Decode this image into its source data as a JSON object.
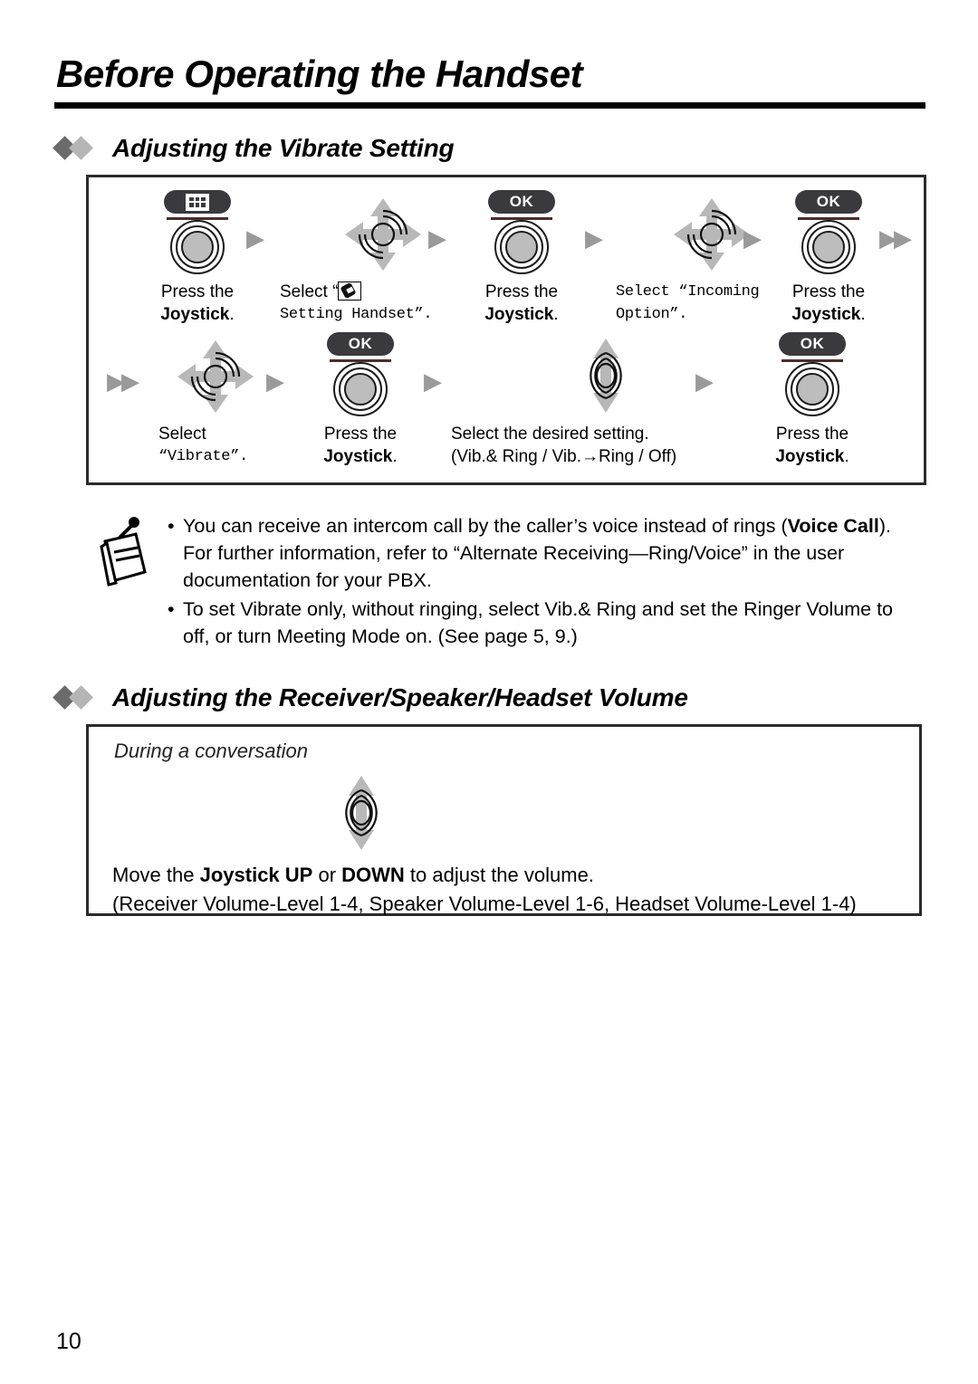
{
  "header": {
    "chapter_title": "Before Operating the Handset"
  },
  "sections": [
    {
      "heading": "Adjusting the Vibrate Setting"
    },
    {
      "heading": "Adjusting the Receiver/Speaker/Headset Volume"
    }
  ],
  "vibrate_procedure": {
    "row1": [
      {
        "icon": "menu-key-press-joystick-icon",
        "key_label": "",
        "line1": "Press the",
        "line2": "Joystick.",
        "line1_mono": false,
        "line2_mono": false,
        "line2_bold": true,
        "trailing_period": "."
      },
      {
        "icon": "joystick-4way-icon",
        "line1": "Select “",
        "line2": "Setting Handset”.",
        "line1_mono": false,
        "line2_mono": true,
        "line2_bold": false
      },
      {
        "icon": "ok-key-press-joystick-icon",
        "key_label": "OK",
        "line1": "Press the",
        "line2": "Joystick.",
        "line2_bold": true
      },
      {
        "icon": "joystick-4way-icon",
        "line1": "Select “Incoming",
        "line2": "Option”.",
        "line1_mono": true,
        "line2_mono": true
      },
      {
        "icon": "ok-key-press-joystick-icon",
        "key_label": "OK",
        "line1": "Press the",
        "line2": "Joystick.",
        "line2_bold": true
      }
    ],
    "row2": [
      {
        "icon": "joystick-4way-icon",
        "line1": "Select",
        "line2": "“Vibrate”.",
        "line2_mono": true
      },
      {
        "icon": "ok-key-press-joystick-icon",
        "key_label": "OK",
        "line1": "Press the",
        "line2": "Joystick.",
        "line2_bold": true
      },
      {
        "icon": "joystick-updown-icon",
        "line1": "Select the desired setting.",
        "line2": "(Vib.& Ring / Vib.→Ring / Off)"
      },
      {
        "icon": "ok-key-press-joystick-icon",
        "key_label": "OK",
        "line1": "Press the",
        "line2": "Joystick.",
        "line2_bold": true
      }
    ],
    "labels": {
      "press_the": "Press the",
      "joystick": "Joystick",
      "period": ".",
      "select": "Select",
      "select_open_quote": "Select “",
      "setting_handset": "Setting Handset”.",
      "select_incoming": "Select “Incoming",
      "option": "Option”.",
      "vibrate": "“Vibrate”.",
      "desired_setting": "Select the desired setting.",
      "desired_options": "(Vib.& Ring / Vib.→Ring / Off)",
      "ok": "OK",
      "wrap_arrow": "▶▶",
      "step_arrow": "▶"
    }
  },
  "note": {
    "icon": "note-memo-icon",
    "bullets": [
      {
        "segments": [
          {
            "text": "You can receive an intercom call by the caller’s voice instead of rings (",
            "bold": false
          },
          {
            "text": "Voice Call",
            "bold": true
          },
          {
            "text": "). For further information, refer to “Alternate Receiving—Ring/Voice” in the user documentation for your PBX.",
            "bold": false
          }
        ]
      },
      {
        "segments": [
          {
            "text": "To set Vibrate only, without ringing, select Vib.& Ring and set the Ringer Volume to off, or turn Meeting Mode on. (See page 5, 9.)",
            "bold": false
          }
        ]
      }
    ]
  },
  "volume_box": {
    "caption": "During a conversation",
    "icon": "joystick-updown-icon",
    "line1_segments": [
      {
        "text": "Move the ",
        "bold": false
      },
      {
        "text": "Joystick UP",
        "bold": true
      },
      {
        "text": " or ",
        "bold": false
      },
      {
        "text": "DOWN",
        "bold": true
      },
      {
        "text": " to adjust the volume.",
        "bold": false
      }
    ],
    "line2": "(Receiver Volume-Level 1-4, Speaker Volume-Level 1-6, Headset Volume-Level 1-4)"
  },
  "footer": {
    "page_number": "10"
  },
  "colors": {
    "arrow_gray": "#9a9a9a",
    "diamond_dark": "#6b6b6b",
    "diamond_light": "#b5b5b5",
    "key_dark": "#3a3a3e",
    "rule_maroon": "#4a2d2d",
    "frame": "#2b2b2b"
  }
}
